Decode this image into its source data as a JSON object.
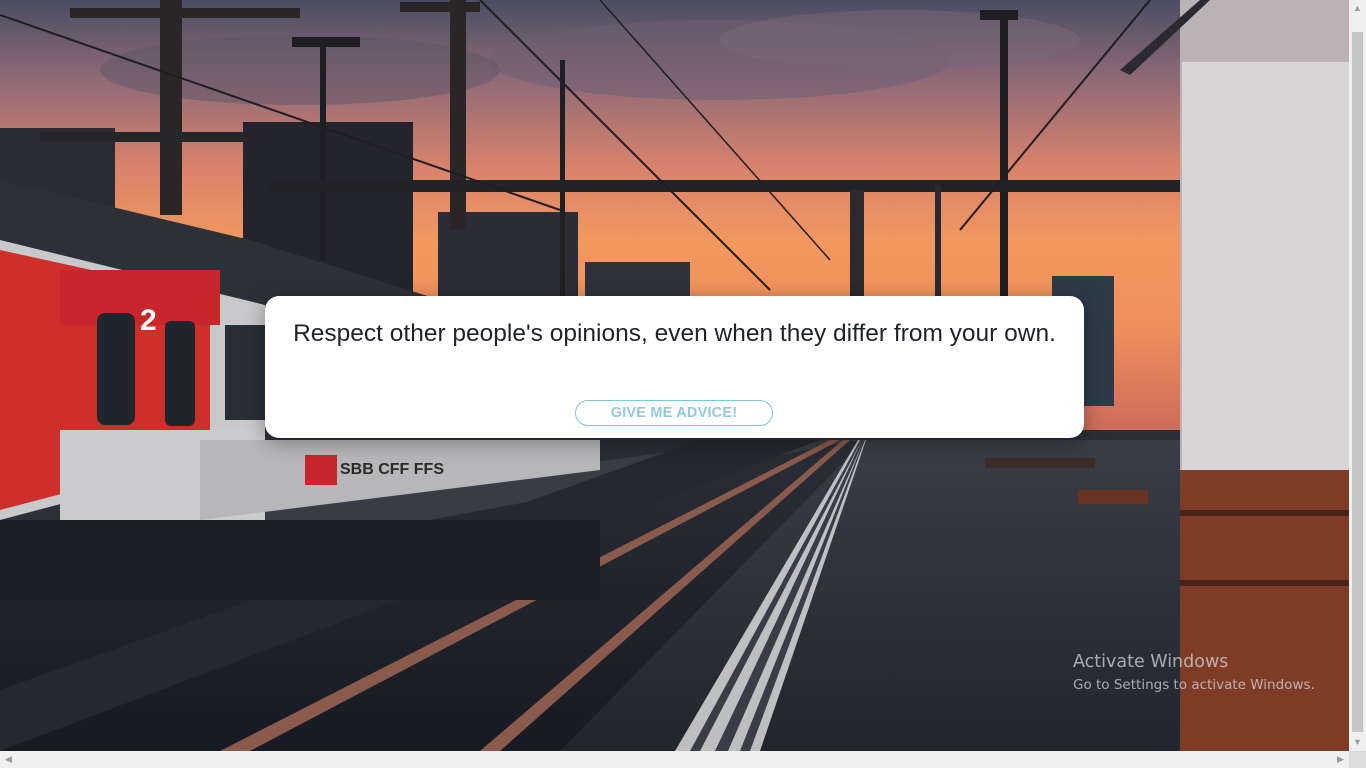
{
  "advice": {
    "text": "Respect other people's opinions, even when they differ from your own.",
    "button_label": "GIVE ME ADVICE!"
  },
  "background": {
    "description_icon": "train-station-sunset-photo",
    "train_car_number": "2",
    "train_brand": "SBB CFF FFS"
  },
  "watermark": {
    "title": "Activate Windows",
    "subtitle": "Go to Settings to activate Windows."
  },
  "scrollbars": {
    "up_icon": "chevron-up-icon",
    "down_icon": "chevron-down-icon",
    "left_icon": "chevron-left-icon",
    "right_icon": "chevron-right-icon"
  },
  "colors": {
    "card_bg": "#ffffff",
    "button_border": "#7fc6d6",
    "button_text": "#8fcadb",
    "sky_top": "#4a4f66",
    "sky_glow": "#f39a5e"
  }
}
